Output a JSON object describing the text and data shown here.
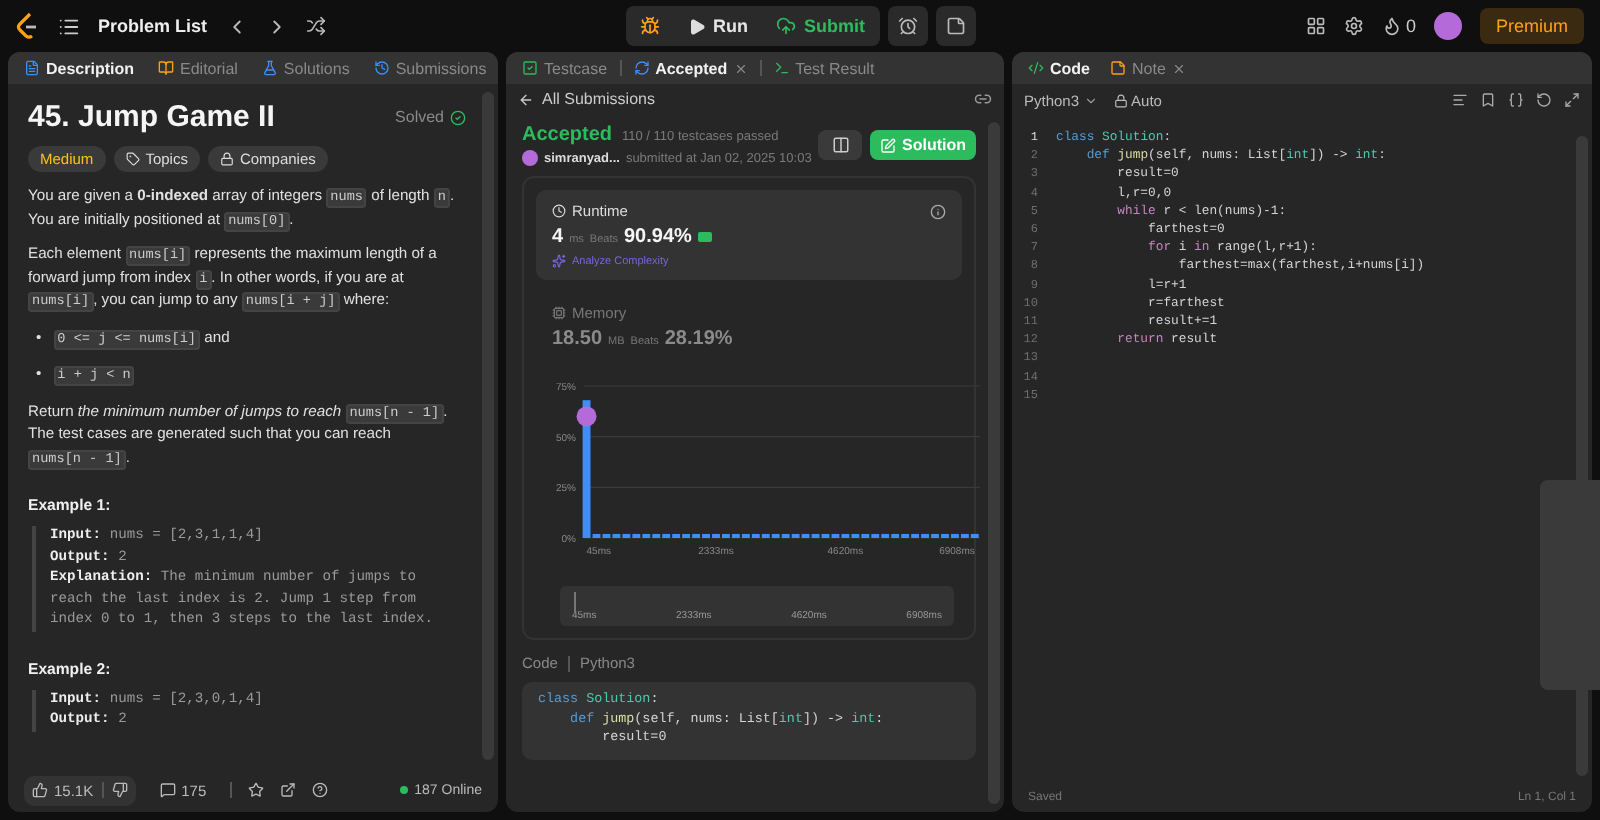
{
  "topbar": {
    "title": "Problem List",
    "run": "Run",
    "submit": "Submit",
    "streak": "0",
    "premium": "Premium"
  },
  "description": {
    "tabs": [
      {
        "label": "Description",
        "selected": true
      },
      {
        "label": "Editorial",
        "selected": false
      },
      {
        "label": "Solutions",
        "selected": false
      },
      {
        "label": "Submissions",
        "selected": false
      }
    ],
    "title": "45. Jump Game II",
    "status": "Solved",
    "tags": [
      {
        "label": "Medium",
        "kind": "difficulty"
      },
      {
        "label": "Topics",
        "kind": "topics"
      },
      {
        "label": "Companies",
        "kind": "companies"
      }
    ],
    "paragraphs": [
      [
        {
          "kind": "text",
          "text": "You are given a "
        },
        {
          "kind": "bold",
          "text": "0-indexed"
        },
        {
          "kind": "text",
          "text": " array of integers "
        },
        {
          "kind": "code",
          "text": "nums"
        },
        {
          "kind": "text",
          "text": " of length "
        },
        {
          "kind": "code",
          "text": "n"
        },
        {
          "kind": "text",
          "text": ". You are initially positioned at "
        },
        {
          "kind": "code",
          "text": "nums[0]"
        },
        {
          "kind": "text",
          "text": "."
        }
      ],
      [
        {
          "kind": "text",
          "text": "Each element "
        },
        {
          "kind": "code",
          "text": "nums[i]"
        },
        {
          "kind": "text",
          "text": " represents the maximum length of a forward jump from index "
        },
        {
          "kind": "code",
          "text": "i"
        },
        {
          "kind": "text",
          "text": ". In other words, if you are at "
        },
        {
          "kind": "code",
          "text": "nums[i]"
        },
        {
          "kind": "text",
          "text": ", you can jump to any "
        },
        {
          "kind": "code",
          "text": "nums[i + j]"
        },
        {
          "kind": "text",
          "text": " where:"
        }
      ]
    ],
    "bullets": [
      {
        "marker": "•",
        "parts": [
          {
            "kind": "code",
            "text": "0 <= j <= nums[i]"
          },
          {
            "kind": "text",
            "text": " and"
          }
        ]
      },
      {
        "marker": "•",
        "parts": [
          {
            "kind": "code",
            "text": "i + j < n"
          }
        ]
      }
    ],
    "closing": [
      {
        "kind": "text",
        "text": "Return "
      },
      {
        "kind": "italic",
        "text": "the minimum number of jumps to reach "
      },
      {
        "kind": "code",
        "text": "nums[n - 1]"
      },
      {
        "kind": "text",
        "text": ". The test cases are generated such that you can reach "
      },
      {
        "kind": "code",
        "text": "nums[n - 1]"
      },
      {
        "kind": "text",
        "text": "."
      }
    ],
    "examples": [
      {
        "title": "Example 1:",
        "lines": [
          {
            "label": "Input:",
            "value": "nums = [2,3,1,1,4]"
          },
          {
            "label": "Output:",
            "value": "2"
          },
          {
            "label": "Explanation:",
            "value": "The minimum number of jumps to reach the last index is 2. Jump 1 step from index 0 to 1, then 3 steps to the last index."
          }
        ]
      },
      {
        "title": "Example 2:",
        "lines": [
          {
            "label": "Input:",
            "value": "nums = [2,3,0,1,4]"
          },
          {
            "label": "Output:",
            "value": "2"
          }
        ]
      }
    ],
    "footer": {
      "likes": "15.1K",
      "comments": "175",
      "online": "187 Online"
    }
  },
  "submission": {
    "tabs": [
      {
        "label": "Testcase",
        "selected": false
      },
      {
        "label": "Accepted",
        "selected": true
      },
      {
        "label": "Test Result",
        "selected": false
      }
    ],
    "back": "All Submissions",
    "status": "Accepted",
    "passed": "110 / 110 testcases passed",
    "user": "simranyad...",
    "submitted": "submitted at Jan 02, 2025 10:03",
    "solution_button": "Solution",
    "runtime": {
      "label": "Runtime",
      "value": "4",
      "unit": "ms",
      "beats_label": "Beats",
      "beats": "90.94%",
      "analyze": "Analyze Complexity"
    },
    "memory": {
      "label": "Memory",
      "value": "18.50",
      "unit": "MB",
      "beats_label": "Beats",
      "beats": "28.19%"
    },
    "chart_data": {
      "type": "bar",
      "x": [
        45,
        221,
        397,
        573,
        749,
        925,
        1101,
        1277,
        1453,
        1629,
        1805,
        1981,
        2157,
        2333,
        2509,
        2685,
        2861,
        3037,
        3213,
        3389,
        3565,
        3741,
        3917,
        4093,
        4269,
        4445,
        4621,
        4797,
        4973,
        5149,
        5325,
        5501,
        5677,
        5853,
        6029,
        6205,
        6381,
        6557,
        6733,
        6908
      ],
      "values": [
        68,
        2,
        2,
        2,
        2,
        2,
        2,
        2,
        2,
        2,
        2,
        2,
        2,
        2,
        2,
        2,
        2,
        2,
        2,
        2,
        2,
        2,
        2,
        2,
        2,
        2,
        2,
        2,
        2,
        2,
        2,
        2,
        2,
        2,
        2,
        2,
        2,
        2,
        2,
        2
      ],
      "xlim": [
        0,
        7000
      ],
      "ylim": [
        0,
        75
      ],
      "xticks": [
        {
          "value": 45,
          "label": "45ms"
        },
        {
          "value": 2333,
          "label": "2333ms"
        },
        {
          "value": 4620,
          "label": "4620ms"
        },
        {
          "value": 6908,
          "label": "6908ms"
        }
      ],
      "yticks": [
        {
          "value": 0,
          "label": "0%"
        },
        {
          "value": 25,
          "label": "25%"
        },
        {
          "value": 50,
          "label": "50%"
        },
        {
          "value": 75,
          "label": "75%"
        }
      ]
    },
    "brush_labels": [
      "45ms",
      "2333ms",
      "4620ms",
      "6908ms"
    ],
    "code_label": "Code",
    "language": "Python3",
    "code": [
      {
        "tokens": [
          {
            "text": "class ",
            "kind": "kw"
          },
          {
            "text": "Solution",
            "kind": "cls"
          },
          {
            "text": ":",
            "kind": "plain"
          }
        ]
      },
      {
        "tokens": [
          {
            "text": "    def ",
            "kind": "kw"
          },
          {
            "text": "jump",
            "kind": "fn"
          },
          {
            "text": "(self, nums: List[",
            "kind": "plain"
          },
          {
            "text": "int",
            "kind": "type"
          },
          {
            "text": "]) -> ",
            "kind": "plain"
          },
          {
            "text": "int",
            "kind": "type"
          },
          {
            "text": ":",
            "kind": "plain"
          }
        ]
      },
      {
        "tokens": [
          {
            "text": "        result=0",
            "kind": "plain"
          }
        ]
      }
    ]
  },
  "editor": {
    "tabs": [
      {
        "label": "Code",
        "selected": true
      },
      {
        "label": "Note",
        "selected": false
      }
    ],
    "language": "Python3",
    "mode": "Auto",
    "lines": [
      {
        "n": "1",
        "tokens": [
          {
            "text": "class ",
            "kind": "kw"
          },
          {
            "text": "Solution",
            "kind": "cls"
          },
          {
            "text": ":",
            "kind": "plain"
          }
        ]
      },
      {
        "n": "2",
        "tokens": [
          {
            "text": "    def ",
            "kind": "kw"
          },
          {
            "text": "jump",
            "kind": "fn"
          },
          {
            "text": "(self, nums: List[",
            "kind": "plain"
          },
          {
            "text": "int",
            "kind": "type"
          },
          {
            "text": "]) -> ",
            "kind": "plain"
          },
          {
            "text": "int",
            "kind": "type"
          },
          {
            "text": ":",
            "kind": "plain"
          }
        ]
      },
      {
        "n": "3",
        "tokens": [
          {
            "text": "        result=0",
            "kind": "plain"
          }
        ]
      },
      {
        "n": "4",
        "tokens": [
          {
            "text": "        l,r=0,0",
            "kind": "plain"
          }
        ]
      },
      {
        "n": "5",
        "tokens": [
          {
            "text": "        while",
            "kind": "ctrl"
          },
          {
            "text": " r < len(nums)-1:",
            "kind": "plain"
          }
        ]
      },
      {
        "n": "6",
        "tokens": [
          {
            "text": "            farthest=0",
            "kind": "plain"
          }
        ]
      },
      {
        "n": "7",
        "tokens": [
          {
            "text": "            for",
            "kind": "ctrl"
          },
          {
            "text": " i ",
            "kind": "plain"
          },
          {
            "text": "in",
            "kind": "ctrl"
          },
          {
            "text": " range(l,r+1):",
            "kind": "plain"
          }
        ]
      },
      {
        "n": "8",
        "tokens": [
          {
            "text": "                farthest=max(farthest,i+nums[i])",
            "kind": "plain"
          }
        ]
      },
      {
        "n": "9",
        "tokens": [
          {
            "text": "            l=r+1",
            "kind": "plain"
          }
        ]
      },
      {
        "n": "10",
        "tokens": [
          {
            "text": "            r=farthest",
            "kind": "plain"
          }
        ]
      },
      {
        "n": "11",
        "tokens": [
          {
            "text": "            result+=1",
            "kind": "plain"
          }
        ]
      },
      {
        "n": "12",
        "tokens": [
          {
            "text": "        return",
            "kind": "ctrl"
          },
          {
            "text": " result",
            "kind": "plain"
          }
        ]
      },
      {
        "n": "13"
      },
      {
        "n": "14"
      },
      {
        "n": "15"
      }
    ],
    "status": "Saved",
    "position": "Ln 1, Col 1"
  }
}
